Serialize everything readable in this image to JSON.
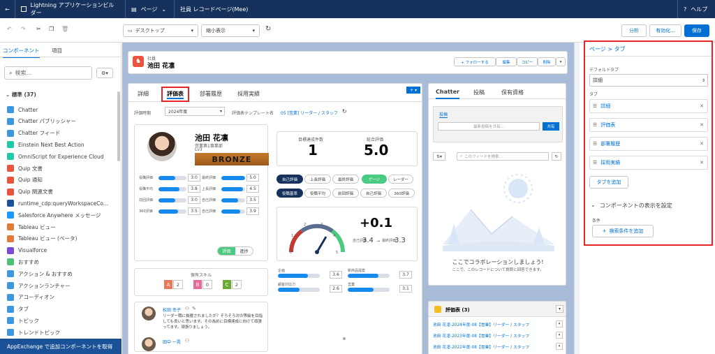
{
  "topbar": {
    "back_icon": "back-arrow-icon",
    "app_title": "Lightning アプリケーションビルダー",
    "page_menu": "ページ",
    "page_name": "社員 レコードページ(Mee)",
    "help": "ヘルプ"
  },
  "toolbar": {
    "device": "デスクトップ",
    "zoom": "縮小表示",
    "analyze": "分析",
    "activate": "有効化...",
    "save": "保存"
  },
  "left": {
    "tabs": [
      "コンポーネント",
      "項目"
    ],
    "search_placeholder": "検索...",
    "section": "標準 (37)",
    "items": [
      {
        "label": "Chatter",
        "color": "#3c97dd"
      },
      {
        "label": "Chatter パブリッシャー",
        "color": "#3c97dd"
      },
      {
        "label": "Chatter フィード",
        "color": "#3c97dd"
      },
      {
        "label": "Einstein Next Best Action",
        "color": "#1fc9a8"
      },
      {
        "label": "OmniScript for Experience Cloud",
        "color": "#1fc9a8"
      },
      {
        "label": "Quip 文書",
        "color": "#e9543f"
      },
      {
        "label": "Quip 通知",
        "color": "#e9543f"
      },
      {
        "label": "Quip 関連文書",
        "color": "#e9543f"
      },
      {
        "label": "runtime_cdp:queryWorkspaceCo...",
        "color": "#1b5297"
      },
      {
        "label": "Salesforce Anywhere メッセージ",
        "color": "#1b96ff"
      },
      {
        "label": "Tableau ビュー",
        "color": "#e07b39"
      },
      {
        "label": "Tableau ビュー (ベータ)",
        "color": "#e07b39"
      },
      {
        "label": "Visualforce",
        "color": "#7a4ad3"
      },
      {
        "label": "おすすめ",
        "color": "#4bc076"
      },
      {
        "label": "アクション & おすすめ",
        "color": "#3c97dd"
      },
      {
        "label": "アクションランチャー",
        "color": "#3c97dd"
      },
      {
        "label": "アコーディオン",
        "color": "#3c97dd"
      },
      {
        "label": "タブ",
        "color": "#3c97dd"
      },
      {
        "label": "トピック",
        "color": "#3c97dd"
      },
      {
        "label": "トレンドトピック",
        "color": "#3c97dd"
      }
    ],
    "appexchange": "AppExchange で追加コンポーネントを取得"
  },
  "header": {
    "object": "社員",
    "name": "池田 花凛",
    "buttons": [
      "+ フォローする",
      "編集",
      "コピー",
      "削除"
    ]
  },
  "main_tabs": [
    "詳細",
    "評価表",
    "部署履歴",
    "採用実績"
  ],
  "eval": {
    "period_label": "評価時期",
    "period": "2024年度",
    "template_label": "評価表テンプレート名",
    "template": "05 [営業] リーダー / スタッフ",
    "person": {
      "name": "池田 花凛",
      "dept": "営業第1事業部",
      "role": "Lv3",
      "rank": "BRONZE"
    },
    "left_bars": [
      {
        "label": "役職評価",
        "v": "3.0"
      },
      {
        "label": "役職平均",
        "v": "3.8"
      },
      {
        "label": "前回評価",
        "v": "3.0"
      },
      {
        "label": "360評価",
        "v": "3.5"
      }
    ],
    "right_bars": [
      {
        "label": "最終評価",
        "v": "5.0"
      },
      {
        "label": "上長評価",
        "v": "4.5"
      },
      {
        "label": "自己評価",
        "v": "3.5"
      },
      {
        "label": "自己評価",
        "v": "3.9"
      }
    ],
    "toggle": [
      "評価",
      "進捗"
    ],
    "skills_title": "保有スキル",
    "skills": [
      {
        "k": "A",
        "v": "2",
        "c": "#e8795b"
      },
      {
        "k": "B",
        "v": "0",
        "c": "#e96a9a"
      },
      {
        "k": "C",
        "v": "2",
        "c": "#6aaa34"
      }
    ],
    "comment": {
      "name": "松田 幸子",
      "text": "リーダー職に抜擢されましたが？そろそろ次の等級を目指しても良いと思います。その為めに目標達成に向けて頑張ってます。頑張りましょう。"
    },
    "comment2": {
      "name": "田中 一晃"
    },
    "kpi": [
      {
        "label": "目標達成件数",
        "value": "1"
      },
      {
        "label": "総合評価",
        "value": "5.0"
      }
    ],
    "filters1": [
      "自己評価",
      "上長評価",
      "最終評価"
    ],
    "filters1b": [
      "ゲージ",
      "レーダー"
    ],
    "filters2": [
      "役職基準",
      "役職平均",
      "前回評価",
      "自己評価",
      "360評価"
    ],
    "gauge": {
      "value": "+0.1",
      "self_label": "自己評価",
      "self": "3.4",
      "to": "最終評価",
      "final": "3.3",
      "ticks": [
        "0",
        "1",
        "2",
        "3",
        "4",
        "5"
      ]
    },
    "metrics": [
      {
        "label": "企画",
        "v": "3.6"
      },
      {
        "label": "新商品提案",
        "v": "3.7"
      },
      {
        "label": "顧客対応力",
        "v": "2.6"
      },
      {
        "label": "営業",
        "v": "3.1"
      }
    ]
  },
  "chatter": {
    "tabs": [
      "Chatter",
      "投稿",
      "保有資格"
    ],
    "post_tab": "投稿",
    "share_placeholder": "最新投稿を共有...",
    "share_btn": "共有",
    "feed_search": "このフィードを検索...",
    "empty_title": "ここでコラボレーションしましょう!",
    "empty_sub": "ここで、このレコードについて質問と回答できます。"
  },
  "related": {
    "title": "評価表 (3)",
    "items": [
      "池田 花凛-2024年度-08【営業】リーダー / スタッフ",
      "池田 花凛-2023年度-08【営業】リーダー / スタッフ",
      "池田 花凛-2022年度-08【営業】リーダー / スタッフ"
    ]
  },
  "rightpanel": {
    "breadcrumb": "ページ > タブ",
    "default_tab_label": "デフォルトタブ",
    "default_tab": "詳細",
    "tabs_label": "タブ",
    "tabs": [
      "詳細",
      "評価表",
      "部署履歴",
      "採用実績"
    ],
    "add_tab": "タブを追加",
    "visibility": "コンポーネントの表示を設定",
    "condition_label": "条件",
    "add_condition": "検索条件を追加"
  }
}
